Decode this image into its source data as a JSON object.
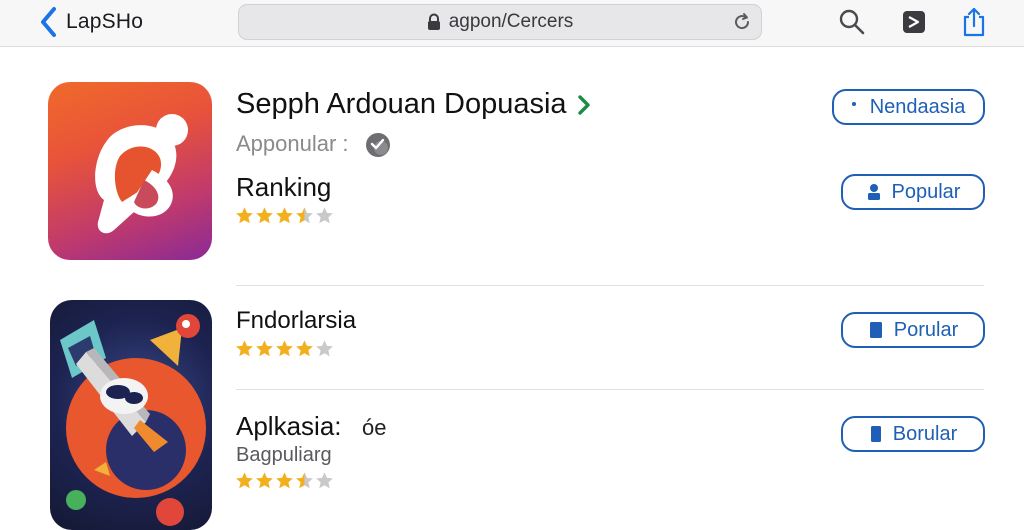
{
  "toolbar": {
    "back_label": "LapSHo",
    "url_text": "agpon/Cercers"
  },
  "apps": [
    {
      "title": "Sepph Ardouan Dopuasia",
      "subtitle": "Apponular :",
      "section_label": "Ranking",
      "rating": 3.5,
      "buttons": [
        "Nendaasia",
        "Popular"
      ]
    },
    {
      "title": "Fndorlarsia",
      "rating": 4,
      "button": "Porular"
    },
    {
      "title": "Aplkasia:",
      "title_glyph": "óe",
      "subtitle": "Bagpuliarg",
      "rating": 3.5,
      "button": "Borular"
    }
  ],
  "colors": {
    "accent": "#1f5fb5",
    "back_chevron": "#1a73e8",
    "star_filled": "#f2b01e",
    "star_empty": "#c9c9cc"
  },
  "icons": {
    "back": "chevron-left-icon",
    "lock": "lock-icon",
    "reload": "reload-icon",
    "search": "search-icon",
    "tabs": "tabs-icon",
    "share": "share-icon",
    "app1": "app-logo-icon",
    "app2": "rocket-game-icon"
  }
}
